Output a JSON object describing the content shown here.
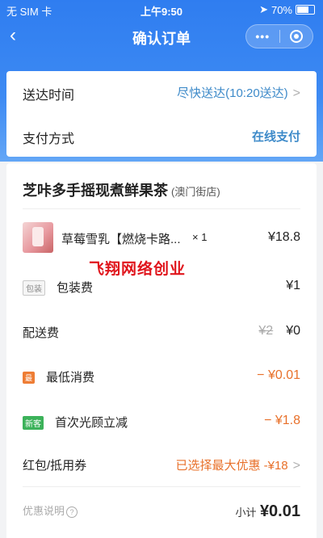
{
  "status_bar": {
    "carrier": "无 SIM 卡",
    "time": "上午9:50",
    "battery": "70%"
  },
  "nav": {
    "back_icon": "chevron-left-icon",
    "title": "确认订单",
    "more": "•••"
  },
  "delivery": {
    "label": "送达时间",
    "value": "尽快送达(10:20送达)"
  },
  "payment": {
    "label": "支付方式",
    "value": "在线支付"
  },
  "store": {
    "name": "芝咔多手摇现煮鲜果茶",
    "branch": "(澳门街店)"
  },
  "item": {
    "name": "草莓雪乳【燃烧卡路...",
    "qty": "× 1",
    "price": "¥18.8"
  },
  "packaging": {
    "badge": "包装",
    "label": "包装费",
    "value": "¥1"
  },
  "delivery_fee": {
    "label": "配送费",
    "original": "¥2",
    "value": "¥0"
  },
  "minimum": {
    "badge": "最",
    "label": "最低消费",
    "value": "− ¥0.01"
  },
  "first_order": {
    "badge": "新客",
    "label": "首次光顾立减",
    "value": "− ¥1.8"
  },
  "coupon": {
    "label": "红包/抵用券",
    "value": "已选择最大优惠 -¥18"
  },
  "discount_note": {
    "label": "优惠说明",
    "icon": "?"
  },
  "subtotal": {
    "label": "小计",
    "value": "¥0.01"
  },
  "watermark": "飞翔网络创业",
  "colors": {
    "primary": "#2f7df0",
    "accent_orange": "#e8702a",
    "green": "#3cb25a",
    "link_blue": "#3d8ac9",
    "watermark_red": "#e0151c"
  }
}
